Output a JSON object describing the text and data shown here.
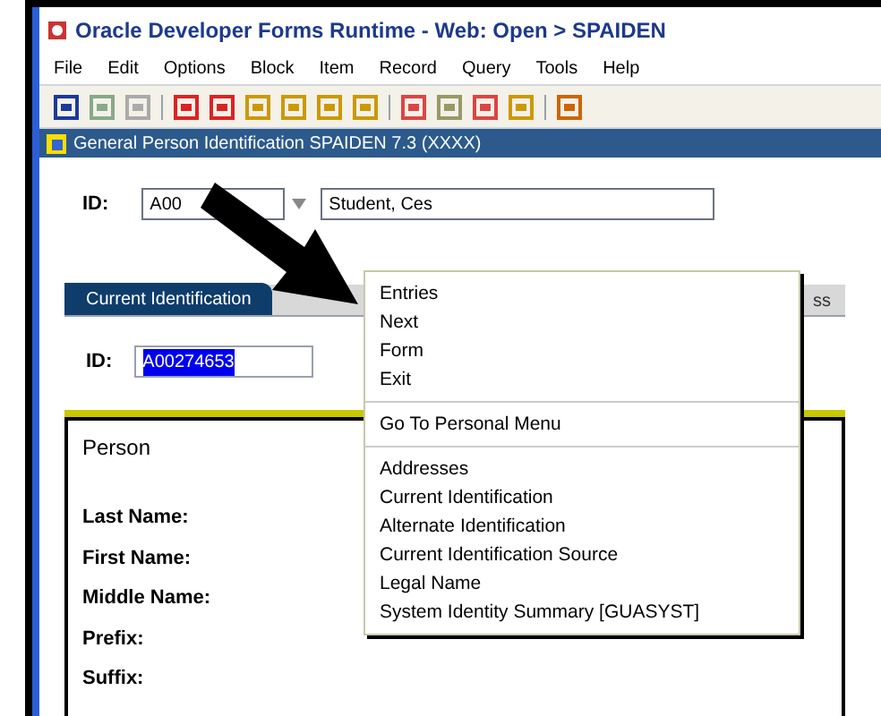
{
  "window": {
    "title": "Oracle Developer Forms Runtime - Web:  Open > SPAIDEN"
  },
  "menu_bar": [
    "File",
    "Edit",
    "Options",
    "Block",
    "Item",
    "Record",
    "Query",
    "Tools",
    "Help"
  ],
  "inner_window": {
    "title": "General Person Identification  SPAIDEN  7.3  (XXXX)"
  },
  "key_block": {
    "label": "ID:",
    "id_value": "A00",
    "name_value": "Student, Ces"
  },
  "tabs": [
    {
      "label": "Current Identification",
      "selected": true
    },
    {
      "label": "ss",
      "selected": false
    }
  ],
  "id_field": {
    "label": "ID:",
    "value": "A00274653",
    "highlighted": true
  },
  "person": {
    "heading": "Person",
    "labels": [
      "Last Name:",
      "First Name:",
      "Middle Name:",
      "Prefix:",
      "Suffix:"
    ]
  },
  "context_menu": {
    "groups": [
      [
        "Entries",
        "Next",
        "Form",
        "Exit"
      ],
      [
        "Go To Personal Menu"
      ],
      [
        "Addresses",
        "Current Identification",
        "Alternate Identification",
        "Current Identification Source",
        "Legal Name",
        "System Identity Summary [GUASYST]"
      ]
    ]
  }
}
